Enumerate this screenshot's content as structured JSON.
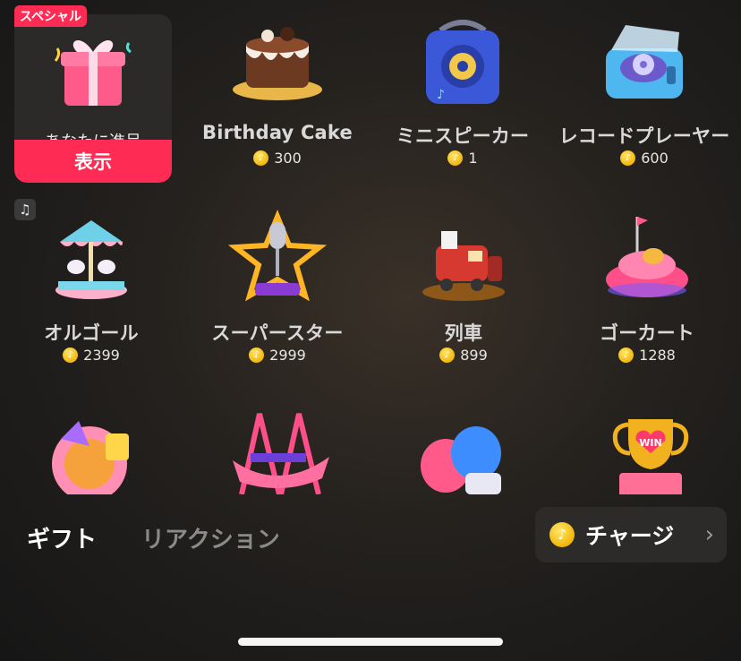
{
  "special": {
    "tag": "スペシャル",
    "label": "あなたに進呈",
    "button": "表示"
  },
  "gifts": [
    {
      "name": "Birthday Cake",
      "price": "300",
      "icon": "birthday-cake-icon"
    },
    {
      "name": "ミニスピーカー",
      "price": "1",
      "icon": "mini-speaker-icon"
    },
    {
      "name": "レコードプレーヤー",
      "price": "600",
      "icon": "record-player-icon"
    },
    {
      "name": "オルゴール",
      "price": "2399",
      "icon": "music-box-icon"
    },
    {
      "name": "スーパースター",
      "price": "2999",
      "icon": "superstar-icon"
    },
    {
      "name": "列車",
      "price": "899",
      "icon": "train-icon"
    },
    {
      "name": "ゴーカート",
      "price": "1288",
      "icon": "go-kart-icon"
    }
  ],
  "partial_gifts": [
    "fan-icon",
    "swing-ship-icon",
    "boxing-glove-icon",
    "trophy-icon"
  ],
  "tabs": {
    "gift": "ギフト",
    "reaction": "リアクション"
  },
  "charge": {
    "label": "チャージ"
  },
  "colors": {
    "accent": "#fe2c55",
    "coin": "#f2b70a"
  }
}
